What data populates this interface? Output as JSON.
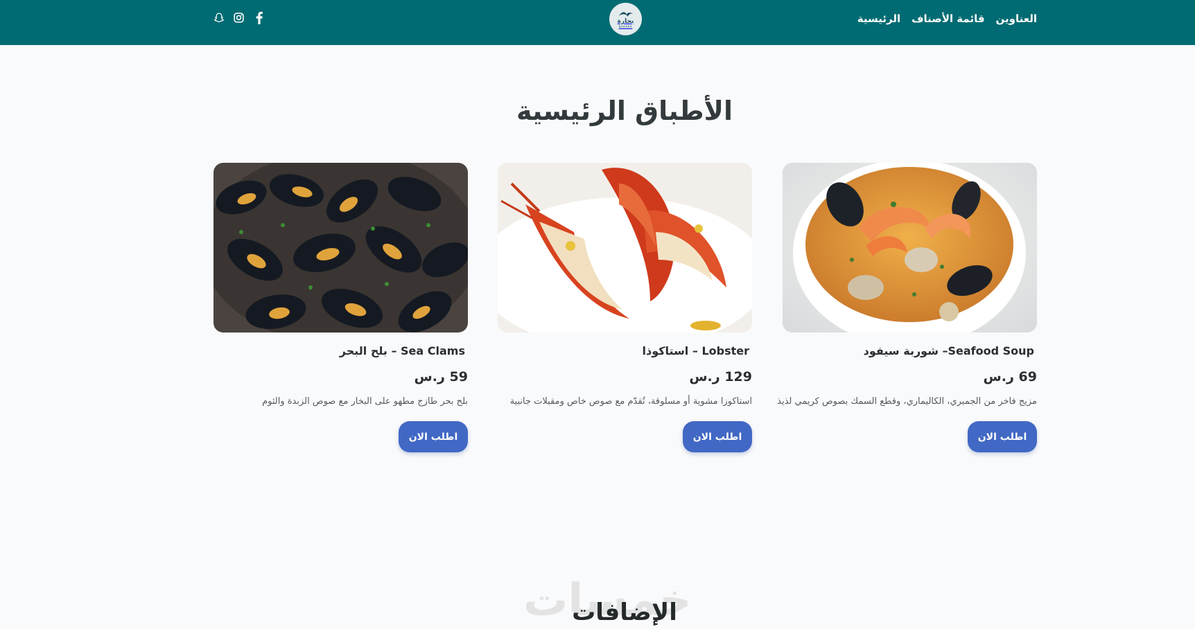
{
  "header": {
    "nav": [
      {
        "label": "الرئيسية"
      },
      {
        "label": "قائمة الأصناف"
      },
      {
        "label": "العناوين"
      }
    ],
    "logo": {
      "text_ar": "بحارة",
      "text_en": "BAHARA"
    },
    "socials": [
      {
        "icon": "facebook-icon"
      },
      {
        "icon": "instagram-icon"
      },
      {
        "icon": "snapchat-icon"
      }
    ],
    "colors": {
      "bar": "#006b72",
      "button": "#4168c4"
    }
  },
  "main_section": {
    "title": "الأطباق الرئيسية",
    "cards": [
      {
        "name": "Seafood Soup– شوربة سيفود",
        "price": "69 ر.س",
        "description": "مزيج فاخر من الجمبري، الكاليماري، وقطع السمك بصوص كريمي لذيذ",
        "button": "اطلب الان",
        "image": "seafood-soup-photo"
      },
      {
        "name": "Lobster – استاكوذا",
        "price": "129 ر.س",
        "description": "استاكوزا مشوية أو مسلوقة، تُقدّم مع صوص خاص ومقبلات جانبية",
        "button": "اطلب الان",
        "image": "lobster-photo"
      },
      {
        "name": "Sea Clams – بلح البحر",
        "price": "59 ر.س",
        "description": "بلح بحر طازج مطهو على البخار مع صوص الزبدة والثوم",
        "button": "اطلب الان",
        "image": "mussels-photo"
      }
    ]
  },
  "extras_section": {
    "title": "الإضافات"
  },
  "watermark": "خمسات"
}
